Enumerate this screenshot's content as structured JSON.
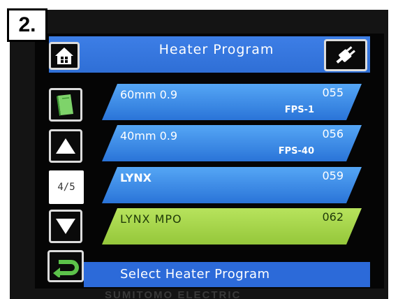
{
  "step_label": "2.",
  "header": {
    "title": "Heater Program"
  },
  "buttons": {
    "home_icon": "house-icon",
    "power_icon": "plug-icon",
    "manual_icon": "book-icon",
    "up_icon": "triangle-up-icon",
    "down_icon": "triangle-down-icon",
    "back_icon": "return-arrow-icon"
  },
  "page_indicator": "4/5",
  "programs": [
    {
      "name": "60mm 0.9",
      "code": "055",
      "type": "FPS-1",
      "color": "blue"
    },
    {
      "name": "40mm 0.9",
      "code": "056",
      "type": "FPS-40",
      "color": "blue"
    },
    {
      "name": "LYNX",
      "code": "059",
      "type": "",
      "color": "blue"
    },
    {
      "name": "LYNX MPO",
      "code": "062",
      "type": "",
      "color": "green",
      "selected": true
    }
  ],
  "status": "Select Heater Program",
  "brand": "SUMITOMO ELECTRIC",
  "colors": {
    "header_blue": "#3d7ee6",
    "row_blue": "#3a8ae8",
    "row_selected_green": "#a6d54a",
    "status_blue": "#2c6ad9",
    "button_green": "#5cc24a"
  }
}
